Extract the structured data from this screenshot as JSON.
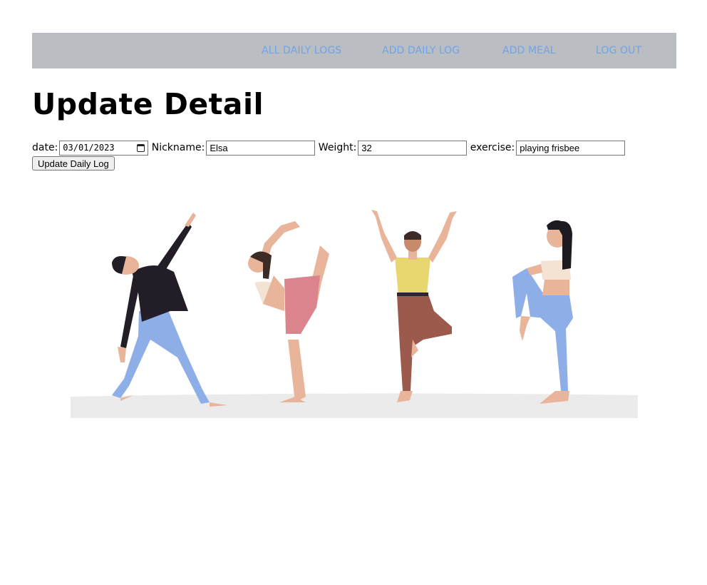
{
  "nav": {
    "links": [
      "ALL DAILY LOGS",
      "ADD DAILY LOG",
      "ADD MEAL",
      "LOG OUT"
    ]
  },
  "page": {
    "title": "Update Detail"
  },
  "form": {
    "date_label": "date:",
    "date_value": "03/01/2023",
    "nickname_label": "Nickname:",
    "nickname_value": "Elsa",
    "weight_label": "Weight:",
    "weight_value": "32",
    "exercise_label": "exercise:",
    "exercise_value": "playing frisbee",
    "submit_label": "Update Daily Log"
  },
  "colors": {
    "navbar_bg": "#babdc1",
    "nav_link": "#6fa4ea"
  },
  "illustration": {
    "icon": "yoga-people-illustration"
  }
}
